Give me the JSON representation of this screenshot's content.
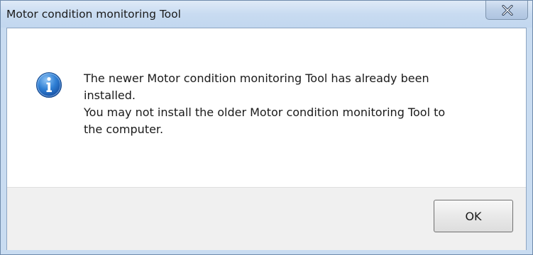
{
  "window": {
    "title": "Motor condition monitoring Tool",
    "frame_color": "#c9dcf1"
  },
  "message": {
    "icon": "information-icon",
    "lines": [
      "The newer Motor condition monitoring Tool  has already been",
      "installed.",
      "You may not install the older Motor condition monitoring Tool to",
      "the computer."
    ]
  },
  "buttons": {
    "ok_label": "OK",
    "close_icon": "close-icon"
  }
}
